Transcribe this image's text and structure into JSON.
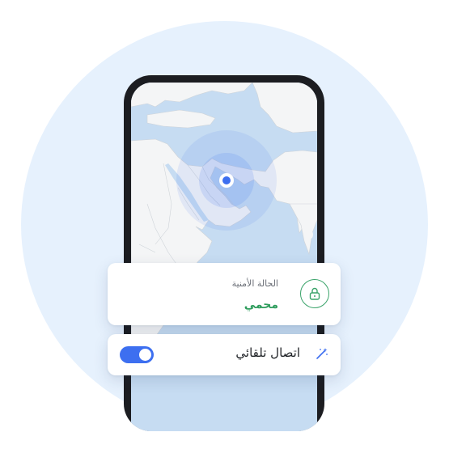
{
  "security_card": {
    "title": "الحالة الأمنية",
    "status": "محمي",
    "icon": "lock-icon"
  },
  "auto_connect": {
    "label": "اتصال تلقائي",
    "icon": "magic-wand-icon",
    "enabled": true
  },
  "colors": {
    "background_circle": "#e6f1fd",
    "map_water": "#c6dcf2",
    "map_land": "#f4f5f6",
    "location_dot": "#3d6ff0",
    "protected_green": "#2f9d5d",
    "toggle_on": "#3d6ff0"
  }
}
